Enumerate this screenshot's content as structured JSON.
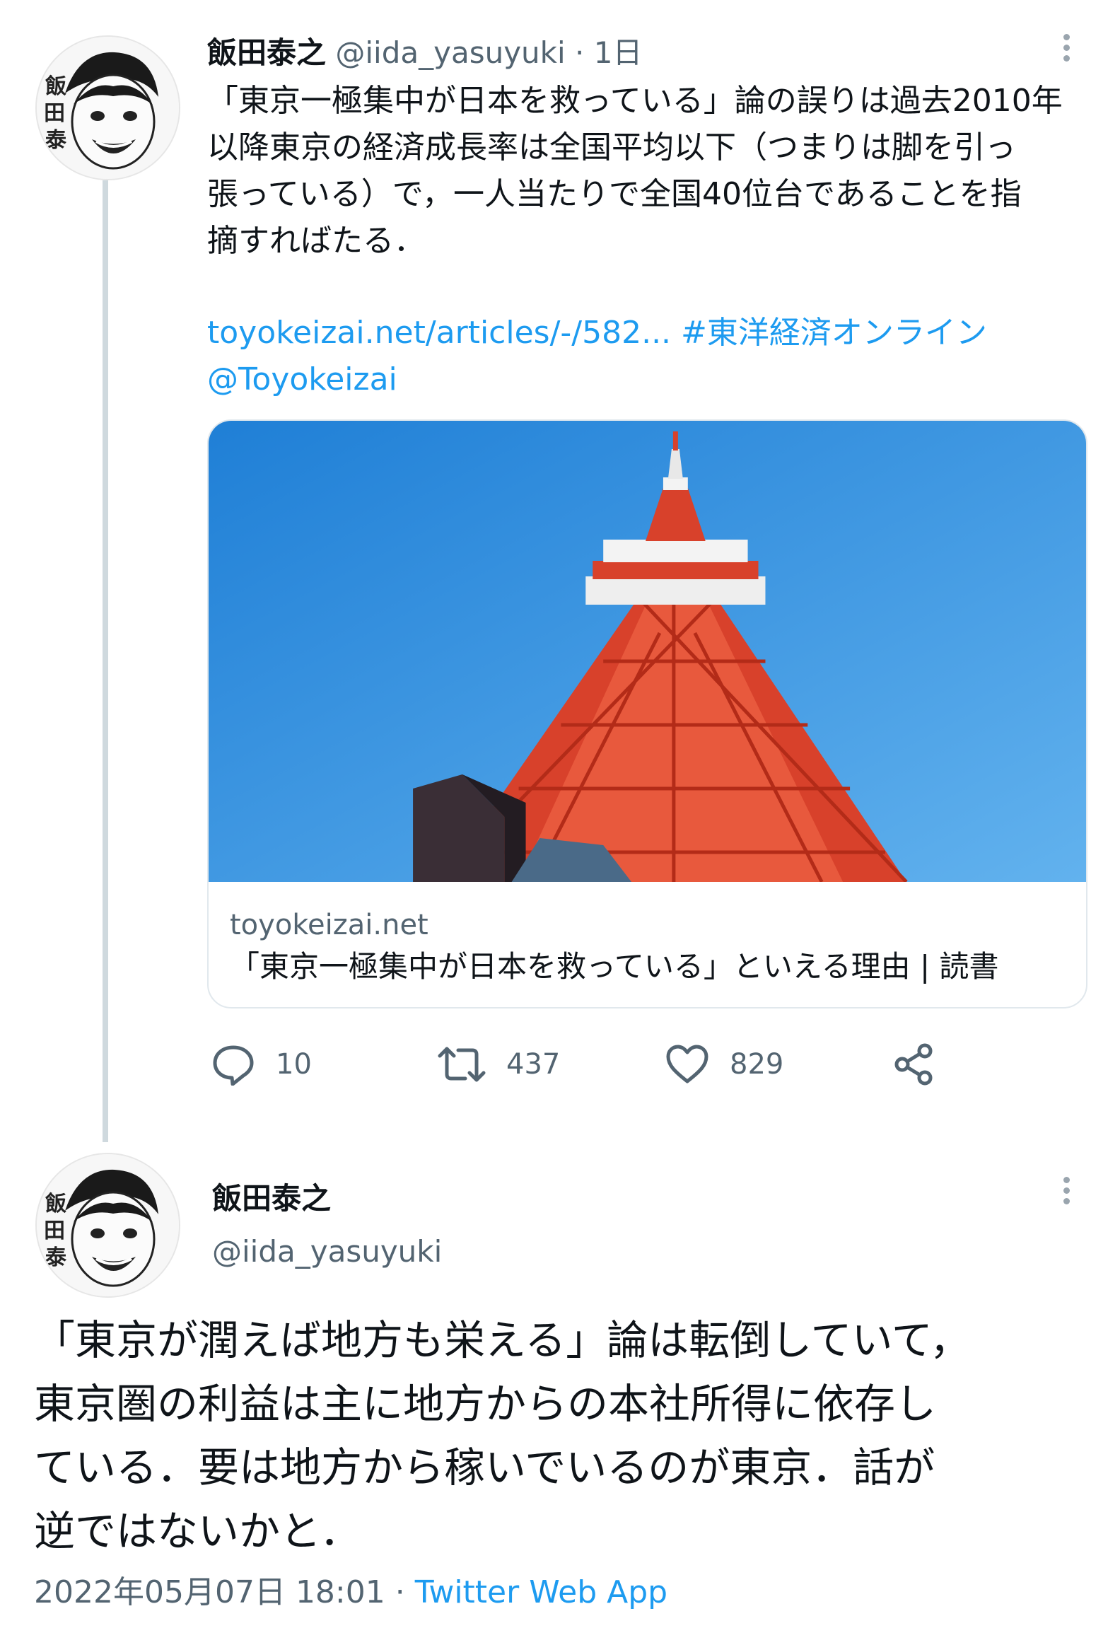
{
  "tweet1": {
    "author_name": "飯田泰之",
    "author_handle": "@iida_yasuyuki",
    "separator": "·",
    "age": "1日",
    "text_lines": [
      "「東京一極集中が日本を救っている」論の誤りは過去2010年",
      "以降東京の経済成長率は全国平均以下（つまりは脚を引っ",
      "張っている）で，一人当たりで全国40位台であることを指",
      "摘すればたる．"
    ],
    "link": "toyokeizai.net/articles/-/582...",
    "hashtag": "#東洋経済オンライン",
    "mention": "@Toyokeizai",
    "card": {
      "domain": "toyokeizai.net",
      "title": "「東京一極集中が日本を救っている」といえる理由 | 読書"
    },
    "actions": {
      "reply_icon": "reply-icon",
      "reply_count": "10",
      "retweet_icon": "retweet-icon",
      "retweet_count": "437",
      "like_icon": "heart-icon",
      "like_count": "829",
      "share_icon": "share-icon"
    }
  },
  "tweet2": {
    "author_name": "飯田泰之",
    "author_handle": "@iida_yasuyuki",
    "text_lines": [
      "「東京が潤えば地方も栄える」論は転倒していて，",
      "東京圏の利益は主に地方からの本社所得に依存し",
      "ている．要は地方から稼いでいるのが東京．話が",
      "逆ではないかと．"
    ],
    "timestamp": "2022年05月07日 18:01",
    "separator": "·",
    "source": "Twitter Web App"
  },
  "avatar_text": "飯田泰之",
  "colors": {
    "link": "#1d9bf0",
    "text": "#0f1419",
    "muted": "#536471",
    "sky": "#3a93dc",
    "tower": "#e0442c"
  }
}
